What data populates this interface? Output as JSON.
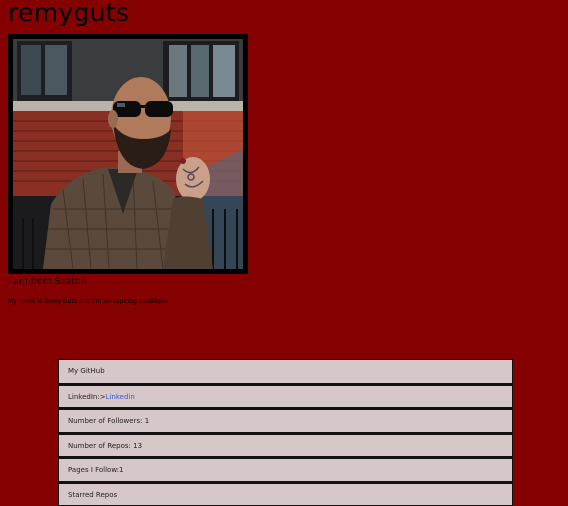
{
  "profile": {
    "username": "remyguts",
    "location": "I am from Seattle",
    "bio": "My name is Remy Guts and I'm an aspiring developer"
  },
  "links": {
    "github_label": "My GitHub",
    "linkedin_prefix": "LinkedIn:>",
    "linkedin_link": "Linkedin",
    "followers_label": "Number of Followers:",
    "followers_count": "1",
    "repos_label": "Number of Repos:",
    "repos_count": "13",
    "following_label": "Pages I Follow:",
    "following_count": "1",
    "starred_label": "Starred Repos"
  },
  "colors": {
    "page_background": "#850000",
    "row_background": "#d6c7c8",
    "link": "#3a58d4"
  },
  "icons": {
    "avatar": "profile-photo"
  }
}
